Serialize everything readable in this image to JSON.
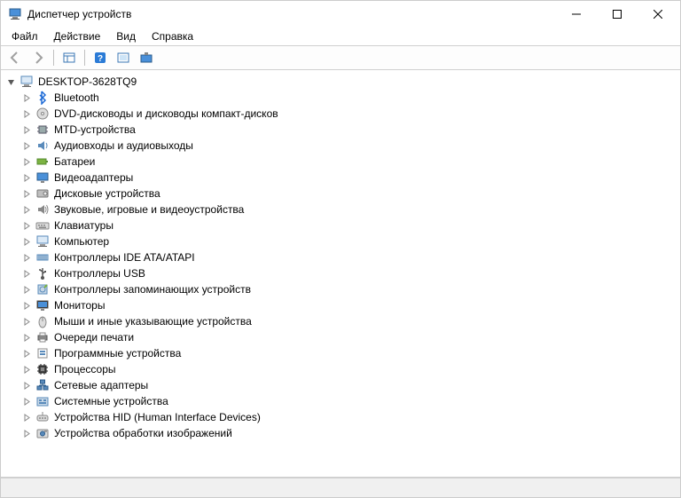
{
  "window": {
    "title": "Диспетчер устройств"
  },
  "menu": {
    "file": "Файл",
    "action": "Действие",
    "view": "Вид",
    "help": "Справка"
  },
  "toolbar": {
    "back": "back",
    "forward": "forward",
    "show_hide": "show-hide",
    "help": "help",
    "refresh": "refresh",
    "properties": "properties"
  },
  "tree": {
    "root": {
      "label": "DESKTOP-3628TQ9",
      "icon": "computer"
    },
    "nodes": [
      {
        "label": "Bluetooth",
        "icon": "bluetooth"
      },
      {
        "label": "DVD-дисководы и дисководы компакт-дисков",
        "icon": "disc"
      },
      {
        "label": "MTD-устройства",
        "icon": "chip"
      },
      {
        "label": "Аудиовходы и аудиовыходы",
        "icon": "audio"
      },
      {
        "label": "Батареи",
        "icon": "battery"
      },
      {
        "label": "Видеоадаптеры",
        "icon": "display"
      },
      {
        "label": "Дисковые устройства",
        "icon": "disk"
      },
      {
        "label": "Звуковые, игровые и видеоустройства",
        "icon": "sound"
      },
      {
        "label": "Клавиатуры",
        "icon": "keyboard"
      },
      {
        "label": "Компьютер",
        "icon": "computer"
      },
      {
        "label": "Контроллеры IDE ATA/ATAPI",
        "icon": "ide"
      },
      {
        "label": "Контроллеры USB",
        "icon": "usb"
      },
      {
        "label": "Контроллеры запоминающих устройств",
        "icon": "storage"
      },
      {
        "label": "Мониторы",
        "icon": "monitor"
      },
      {
        "label": "Мыши и иные указывающие устройства",
        "icon": "mouse"
      },
      {
        "label": "Очереди печати",
        "icon": "printer"
      },
      {
        "label": "Программные устройства",
        "icon": "software"
      },
      {
        "label": "Процессоры",
        "icon": "cpu"
      },
      {
        "label": "Сетевые адаптеры",
        "icon": "network"
      },
      {
        "label": "Системные устройства",
        "icon": "system"
      },
      {
        "label": "Устройства HID (Human Interface Devices)",
        "icon": "hid"
      },
      {
        "label": "Устройства обработки изображений",
        "icon": "imaging"
      }
    ]
  }
}
